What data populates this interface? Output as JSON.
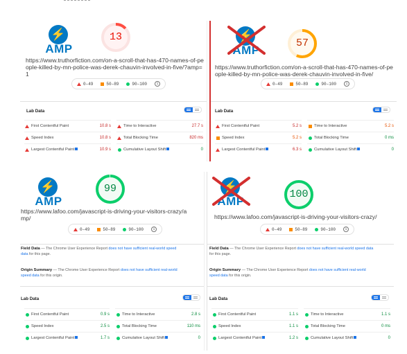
{
  "panels": [
    {
      "amp_crossed": false,
      "score": "13",
      "score_color": "#ff4e42",
      "score_fraction": 0.13,
      "url": "https://www.truthorfiction.com/on-a-scroll-that-has-470-names-of-people-killed-by-mn-police-was-derek-chauvin-involved-in-five/?amp=1",
      "metrics": [
        {
          "label": "First Contentful Paint",
          "value": "10.8 s",
          "status": "red"
        },
        {
          "label": "Time to Interactive",
          "value": "27.7 s",
          "status": "red"
        },
        {
          "label": "Speed Index",
          "value": "10.8 s",
          "status": "red"
        },
        {
          "label": "Total Blocking Time",
          "value": "820 ms",
          "status": "red"
        },
        {
          "label": "Largest Contentful Paint",
          "value": "10.9 s",
          "status": "red",
          "flag": true
        },
        {
          "label": "Cumulative Layout Shift",
          "value": "0",
          "status": "green",
          "flag": true
        }
      ]
    },
    {
      "amp_crossed": true,
      "score": "57",
      "score_color": "#ffa400",
      "score_fraction": 0.57,
      "url": "https://www.truthorfiction.com/on-a-scroll-that-has-470-names-of-people-killed-by-mn-police-was-derek-chauvin-involved-in-five/",
      "metrics": [
        {
          "label": "First Contentful Paint",
          "value": "5.2 s",
          "status": "red"
        },
        {
          "label": "Time to Interactive",
          "value": "5.2 s",
          "status": "orange"
        },
        {
          "label": "Speed Index",
          "value": "5.2 s",
          "status": "orange"
        },
        {
          "label": "Total Blocking Time",
          "value": "0 ms",
          "status": "green"
        },
        {
          "label": "Largest Contentful Paint",
          "value": "6.3 s",
          "status": "red",
          "flag": true
        },
        {
          "label": "Cumulative Layout Shift",
          "value": "0",
          "status": "green",
          "flag": true
        }
      ]
    },
    {
      "amp_crossed": false,
      "score": "99",
      "score_color": "#0cce6b",
      "score_fraction": 0.99,
      "url": "https://www.lafoo.com/javascript-is-driving-your-visitors-crazy/amp/",
      "field_title": "Field Data",
      "field_text_a": " — The Chrome User Experience Report ",
      "field_link": "does not have sufficient real-world speed data",
      "field_text_b": " for this page.",
      "origin_title": "Origin Summary",
      "origin_text_a": " — The Chrome User Experience Report ",
      "origin_link": "does not have sufficient real-world speed data",
      "origin_text_b": " for this origin.",
      "metrics": [
        {
          "label": "First Contentful Paint",
          "value": "0.9 s",
          "status": "green"
        },
        {
          "label": "Time to Interactive",
          "value": "2.8 s",
          "status": "green"
        },
        {
          "label": "Speed Index",
          "value": "2.5 s",
          "status": "green"
        },
        {
          "label": "Total Blocking Time",
          "value": "110 ms",
          "status": "green"
        },
        {
          "label": "Largest Contentful Paint",
          "value": "1.7 s",
          "status": "green",
          "flag": true
        },
        {
          "label": "Cumulative Layout Shift",
          "value": "0",
          "status": "green",
          "flag": true
        }
      ]
    },
    {
      "amp_crossed": true,
      "score": "100",
      "score_color": "#0cce6b",
      "score_fraction": 1.0,
      "url": "https://www.lafoo.com/javascript-is-driving-your-visitors-crazy/",
      "field_title": "Field Data",
      "field_text_a": " — The Chrome User Experience Report ",
      "field_link": "does not have sufficient real-world speed data",
      "field_text_b": " for this page.",
      "origin_title": "Origin Summary",
      "origin_text_a": " — The Chrome User Experience Report ",
      "origin_link": "does not have sufficient real-world speed data",
      "origin_text_b": " for this origin.",
      "metrics": [
        {
          "label": "First Contentful Paint",
          "value": "1.1 s",
          "status": "green"
        },
        {
          "label": "Time to Interactive",
          "value": "1.1 s",
          "status": "green"
        },
        {
          "label": "Speed Index",
          "value": "1.1 s",
          "status": "green"
        },
        {
          "label": "Total Blocking Time",
          "value": "0 ms",
          "status": "green"
        },
        {
          "label": "Largest Contentful Paint",
          "value": "1.2 s",
          "status": "green",
          "flag": true
        },
        {
          "label": "Cumulative Layout Shift",
          "value": "0",
          "status": "green",
          "flag": true
        }
      ]
    }
  ],
  "legend": {
    "fail": "0–49",
    "average": "50–89",
    "pass": "90–100"
  },
  "lab_data_title": "Lab Data",
  "amp_logo_text": "AMP",
  "colors": {
    "fail": "#e53935",
    "average": "#fb8c00",
    "pass": "#0cce6b",
    "accent": "#1a73e8",
    "amp": "#0379c4",
    "cross": "#d32f2f"
  }
}
